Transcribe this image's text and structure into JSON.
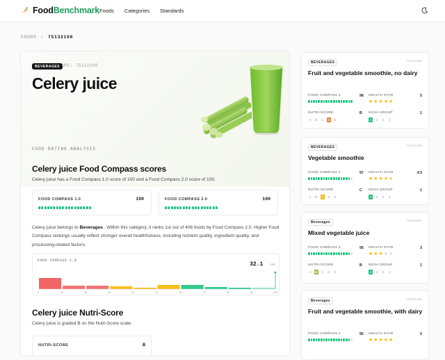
{
  "brand": {
    "name_a": "Food",
    "name_b": "Benchmark",
    "accent": "#1f9d5b"
  },
  "nav": [
    "Foods",
    "Categories",
    "Standards"
  ],
  "breadcrumb": {
    "root": "FOODS",
    "current": "75132100"
  },
  "product": {
    "badge": "BEVERAGES",
    "upc": "UPC: 75132100",
    "title": "Celery juice"
  },
  "section_label": "FOOD RATING ANALYSIS",
  "compass": {
    "heading": "Celery juice Food Compass scores",
    "summary": "Celery juice has a Food Compass 1.0 score of 100 and a Food Compass 2.0 score of 100.",
    "fc1_label": "FOOD COMPASS 1.0",
    "fc1_value": "100",
    "fc1_level": 1.0,
    "fc2_label": "FOOD COMPASS 2.0",
    "fc2_value": "100",
    "fc2_level": 1.0,
    "para_a": "Celery juice belongs to ",
    "para_category": "Beverages",
    "para_b": " . Within this category, it ranks 1st out of 406 foods by Food Compass 2.0. Higher Food Compass rankings usually reflect stronger overall healthfulness, including nutrient quality, ingredient quality, and processing-related factors."
  },
  "chart_data": {
    "type": "bar",
    "title": "FOOD COMPASS 2.0",
    "avg_value": "32.1",
    "avg_label": "AVG",
    "x_ticks": [
      "0",
      "10",
      "20",
      "30",
      "40",
      "50",
      "60",
      "70",
      "80",
      "90",
      "100"
    ],
    "bins": [
      0,
      10,
      20,
      30,
      40,
      50,
      60,
      70,
      80,
      90
    ],
    "values": [
      16,
      5,
      5,
      4,
      2,
      6,
      6,
      3,
      2,
      1
    ],
    "marker_value": 100
  },
  "nutri": {
    "heading": "Celery juice Nutri-Score",
    "summary": "Celery juice is graded B on the Nutri-Score scale.",
    "label": "NUTRI-SCORE",
    "value": "B"
  },
  "sidebar": [
    {
      "badge": "BEVERAGES",
      "code": "75132100",
      "name": "Fruit and vegetable smoothie, no dairy",
      "fc_label": "FOOD COMPASS 2",
      "fc_value": "98",
      "fc_level": 0.98,
      "hs_label": "HEALTH STAR",
      "hs_value": "5",
      "stars": 5,
      "ns_label": "NUTRI-SCORE",
      "ns_value": "B",
      "ns_active": "D",
      "nova_label": "NOVA GROUP",
      "nova_value": "1"
    },
    {
      "badge": "BEVERAGES",
      "code": "75132100",
      "name": "Vegetable smoothie",
      "fc_label": "FOOD COMPASS 2",
      "fc_value": "97",
      "fc_level": 0.97,
      "hs_label": "HEALTH STAR",
      "hs_value": "4.5",
      "stars": 4.5,
      "ns_label": "NUTRI-SCORE",
      "ns_value": "C",
      "ns_active": "C",
      "nova_label": "NOVA GROUP",
      "nova_value": "1"
    },
    {
      "badge": "Beverages",
      "code": "75132000",
      "name": "Mixed vegetable juice",
      "fc_label": "FOOD COMPASS 2",
      "fc_value": "95",
      "fc_level": 0.95,
      "hs_label": "HEALTH STAR",
      "hs_value": "3",
      "stars": 3,
      "ns_label": "NUTRI-SCORE",
      "ns_value": "B",
      "ns_active": "B",
      "nova_label": "NOVA GROUP",
      "nova_value": "1"
    },
    {
      "badge": "Beverages",
      "code": "75132100",
      "name": "Fruit and vegetable smoothie, with dairy",
      "fc_label": "FOOD COMPASS 2",
      "fc_value": "95",
      "fc_level": 0.95,
      "hs_label": "HEALTH STAR",
      "hs_value": "5",
      "stars": 5
    }
  ],
  "colors": {
    "green": "#1bc47d",
    "red": "#f06565",
    "yellow": "#f5b800",
    "orange": "#ef7d2a",
    "lime": "#8bc34a"
  }
}
